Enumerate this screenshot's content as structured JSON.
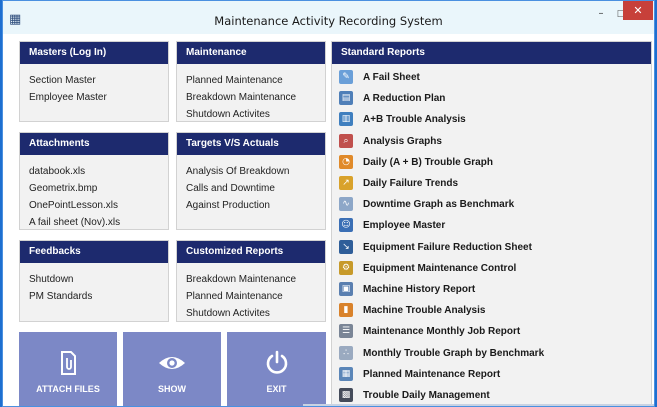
{
  "window": {
    "title": "Maintenance Activity Recording System",
    "icon": "grid-app-icon",
    "minimize_glyph": "–",
    "maximize_glyph": "□",
    "close_glyph": "✕"
  },
  "panels": {
    "masters": {
      "heading": "Masters (Log In)",
      "items": [
        "Section Master",
        "Employee Master"
      ]
    },
    "maintenance": {
      "heading": "Maintenance",
      "items": [
        "Planned Maintenance",
        "Breakdown Maintenance",
        "Shutdown Activites"
      ]
    },
    "attachments": {
      "heading": "Attachments",
      "items": [
        "databook.xls",
        "Geometrix.bmp",
        "OnePointLesson.xls",
        "A fail sheet (Nov).xls"
      ]
    },
    "targets": {
      "heading": "Targets V/S Actuals",
      "items": [
        "Analysis Of Breakdown",
        "Calls and Downtime",
        "Against Production"
      ]
    },
    "feedbacks": {
      "heading": "Feedbacks",
      "items": [
        "Shutdown",
        "PM Standards"
      ]
    },
    "customized": {
      "heading": "Customized Reports",
      "items": [
        "Breakdown Maintenance",
        "Planned Maintenance",
        "Shutdown Activites"
      ]
    }
  },
  "buttons": {
    "attach": {
      "label": "ATTACH FILES",
      "icon": "paperclip-file-icon"
    },
    "show": {
      "label": "SHOW",
      "icon": "eye-icon"
    },
    "exit": {
      "label": "EXIT",
      "icon": "power-icon"
    }
  },
  "standard_reports": {
    "heading": "Standard Reports",
    "items": [
      {
        "label": "A Fail Sheet",
        "icon": "document-edit-icon",
        "color": "#6a9fd8"
      },
      {
        "label": "A Reduction Plan",
        "icon": "document-icon",
        "color": "#4f7fb8"
      },
      {
        "label": "A+B Trouble Analysis",
        "icon": "bar-chart-icon",
        "color": "#3f7fbf"
      },
      {
        "label": "Analysis Graphs",
        "icon": "magnifier-chart-icon",
        "color": "#c0504d"
      },
      {
        "label": "Daily (A + B) Trouble Graph",
        "icon": "pie-chart-icon",
        "color": "#e08a2a"
      },
      {
        "label": "Daily Failure Trends",
        "icon": "trend-chart-icon",
        "color": "#d9a22b"
      },
      {
        "label": "Downtime Graph as Benchmark",
        "icon": "line-graph-icon",
        "color": "#8da7c8"
      },
      {
        "label": "Employee Master",
        "icon": "users-icon",
        "color": "#3b6fb5"
      },
      {
        "label": "Equipment Failure Reduction Sheet",
        "icon": "arrow-document-icon",
        "color": "#2f5e99"
      },
      {
        "label": "Equipment Maintenance Control",
        "icon": "wrench-gear-icon",
        "color": "#c79a2a"
      },
      {
        "label": "Machine History Report",
        "icon": "report-icon",
        "color": "#5a7fb0"
      },
      {
        "label": "Machine Trouble Analysis",
        "icon": "column-chart-icon",
        "color": "#d9822b"
      },
      {
        "label": "Maintenance Monthly Job Report",
        "icon": "checklist-icon",
        "color": "#7a8596"
      },
      {
        "label": "Monthly Trouble Graph by Benchmark",
        "icon": "scatter-graph-icon",
        "color": "#9aaac0"
      },
      {
        "label": "Planned Maintenance Report",
        "icon": "calendar-document-icon",
        "color": "#5b86b8"
      },
      {
        "label": "Trouble Daily Management",
        "icon": "calendar-icon",
        "color": "#444b5a"
      }
    ]
  }
}
